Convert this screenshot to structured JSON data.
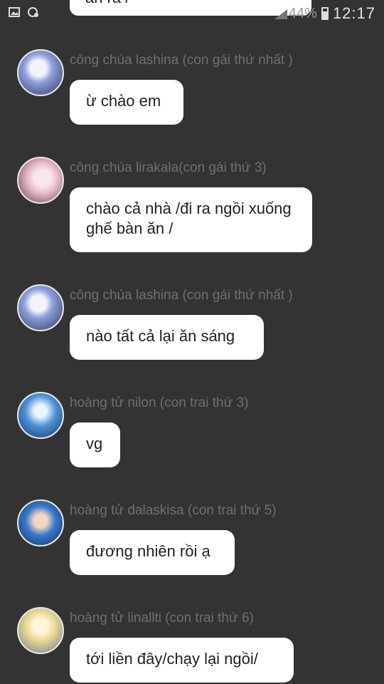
{
  "status_bar": {
    "time": "12:17",
    "battery": "44%",
    "icons": [
      "image-icon",
      "settings-notification-icon",
      "signal-icon",
      "battery-icon"
    ]
  },
  "top_partial_message": {
    "text": "ăn ra /"
  },
  "messages": [
    {
      "sender": "công chúa lashina (con gái thứ nhất )",
      "text": "ừ chào em",
      "avatar_color": "#6b7fb3"
    },
    {
      "sender": "công chúa lirakala(con gái thứ 3)",
      "text": "chào cả nhà /đi ra ngồi xuống ghế bàn ăn /",
      "avatar_color": "#e8b9c6"
    },
    {
      "sender": "công chúa lashina (con gái thứ nhất )",
      "text": "nào tất cả lại ăn sáng",
      "avatar_color": "#6b7fb3"
    },
    {
      "sender": "hoàng tử nilon  (con trai thứ 3)",
      "text": "vg",
      "avatar_color": "#4d8fd6"
    },
    {
      "sender": "hoàng tử dalaskisa (con trai thứ 5)",
      "text": "đương nhiên rồi ạ",
      "avatar_color": "#3a78c9"
    },
    {
      "sender": "hoàng tử linallti (con trai thứ 6)",
      "text": "tới liền đây/chạy lại ngồi/",
      "avatar_color": "#e7d48f"
    }
  ]
}
